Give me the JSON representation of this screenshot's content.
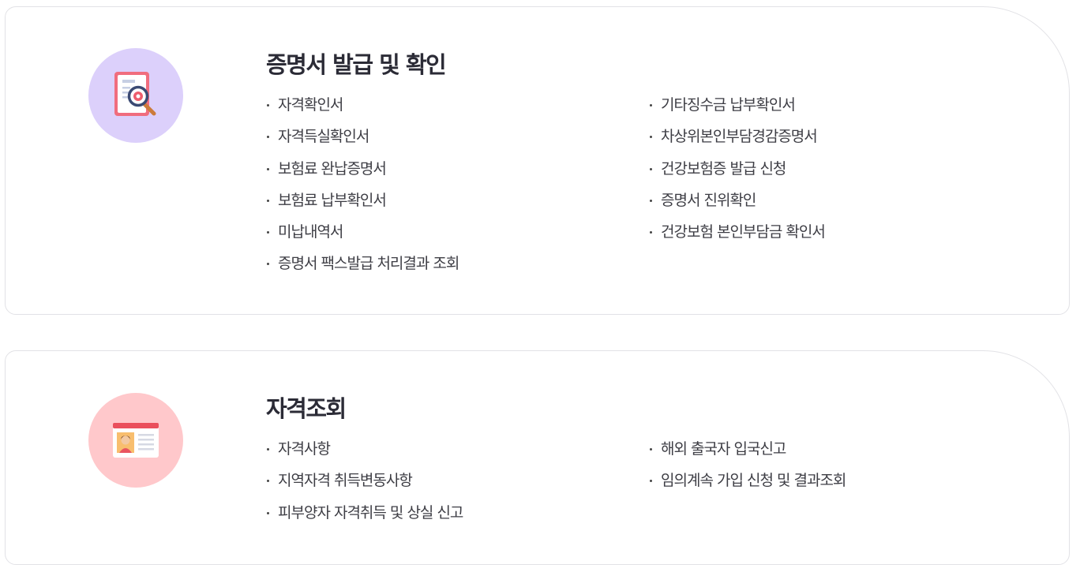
{
  "sections": [
    {
      "title": "증명서 발급 및 확인",
      "icon": "certificate-search-icon",
      "icon_bg": "#dcd0fb",
      "left_links": [
        "자격확인서",
        "자격득실확인서",
        "보험료 완납증명서",
        "보험료 납부확인서",
        "미납내역서",
        "증명서 팩스발급 처리결과 조회"
      ],
      "right_links": [
        "기타징수금 납부확인서",
        "차상위본인부담경감증명서",
        "건강보험증 발급 신청",
        "증명서 진위확인",
        "건강보험 본인부담금 확인서"
      ]
    },
    {
      "title": "자격조회",
      "icon": "id-card-icon",
      "icon_bg": "#ffc8cb",
      "left_links": [
        "자격사항",
        "지역자격 취득변동사항",
        "피부양자 자격취득 및 상실 신고"
      ],
      "right_links": [
        "해외 출국자 입국신고",
        "임의계속 가입 신청 및 결과조회"
      ]
    }
  ]
}
